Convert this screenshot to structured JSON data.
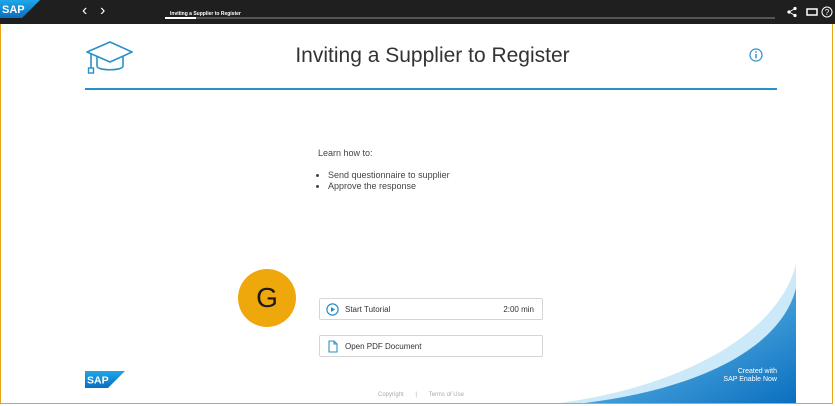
{
  "topbar": {
    "logo_text": "SAP",
    "back_glyph": "‹",
    "forward_glyph": "›",
    "breadcrumb": "Inviting a Supplier to Register",
    "progress_fraction": 0.05,
    "icons": [
      "share-icon",
      "window-icon",
      "help-icon"
    ]
  },
  "header": {
    "title": "Inviting a Supplier to Register",
    "hat_icon": "graduation-cap-icon",
    "info_icon": "info-icon"
  },
  "colors": {
    "accent": "#2a8fc9",
    "marker": "#efa80c",
    "topbar": "#1f1f1f",
    "frame": "#e8a317"
  },
  "intro": {
    "heading": "Learn how to:",
    "points": [
      "Send questionnaire to supplier",
      "Approve the response"
    ]
  },
  "marker": {
    "label": "G"
  },
  "actions": {
    "start": {
      "label": "Start Tutorial",
      "duration": "2:00 min",
      "icon": "play-icon"
    },
    "pdf": {
      "label": "Open PDF Document",
      "icon": "document-icon"
    }
  },
  "footer": {
    "logo_text": "SAP",
    "created_line1": "Created with",
    "created_line2": "SAP Enable Now",
    "copyright": "Copyright",
    "separator": "|",
    "terms": "Terms of Use"
  }
}
